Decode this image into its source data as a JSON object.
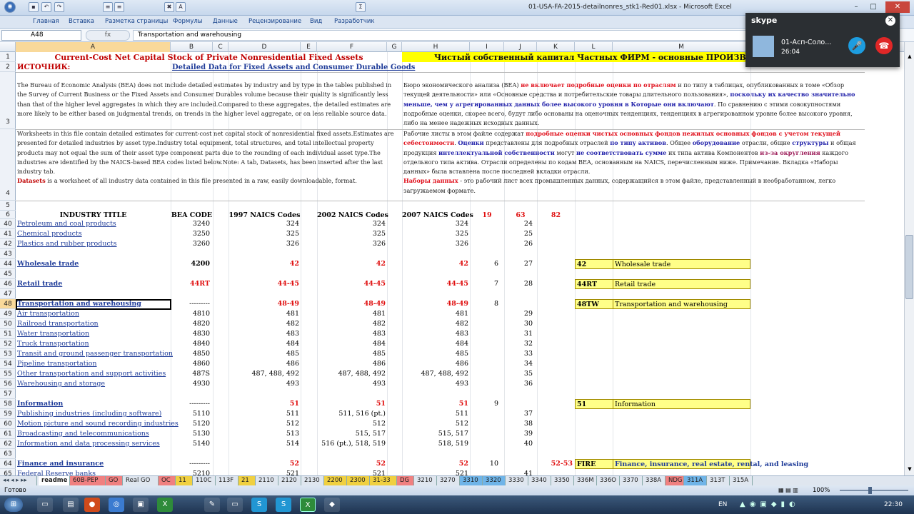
{
  "window": {
    "title": "01-USA-FA-2015-detailnonres_stk1-Red01.xlsx - Microsoft Excel"
  },
  "ribbon_tabs": [
    "Главная",
    "Вставка",
    "Разметка страницы",
    "Формулы",
    "Данные",
    "Рецензирование",
    "Вид",
    "Разработчик"
  ],
  "formula_bar": {
    "name_box": "A48",
    "fx": "fx",
    "value": "Transportation and warehousing"
  },
  "columns": [
    "A",
    "B",
    "C",
    "D",
    "E",
    "F",
    "G",
    "H",
    "I",
    "J",
    "K",
    "L",
    "M"
  ],
  "header": {
    "title_en": "Current-Cost Net Capital Stock of Private Nonresidential Fixed Assets",
    "title_ru": "Чистый собственный капитал Частных ФИРМ - основные ПРОИЗВОД",
    "source_label": "ИСТОЧНИК:",
    "source_link": "Detailed Data for Fixed Assets and Consumer Durable Goods"
  },
  "para_en_1": "The Bureau of Economic Analysis (BEA) does not include detailed estimates by industry and by type in the tables published in the Survey of Current Business or the Fixed Assets and Consumer Durables volume because their quality is significantly less than that of the higher level aggregates in which they are included.Compared to these aggregates, the detailed estimates are more likely to be either based on judgmental trends, on trends in the higher level aggregate, or on less reliable source data.",
  "para_en_2": "Worksheets in this file contain detailed estimates for current-cost net capital stock of nonresidential fixed assets.Estimates are presented for detailed industries by asset type.Industry total equipment, total structures, and total intellectual property products may not equal the sum of their asset type component parts due to the rounding of each individual asset type.The industries are identified by the NAICS-based BEA codes listed below.Note: A tab, Datasets, has been inserted after the last industry tab.",
  "para_en_2b": "Datasets",
  "para_en_2c": " is a worksheet of all industry data contained in this file presented in a raw, easily downloadable, format.",
  "para_ru_1": {
    "a": "Бюро экономического анализа (BEA) ",
    "b": "не включает подробные оценки по отраслям",
    "c": " и по типу в таблицах, опубликованных в томе «Обзор текущей деятельности» или «Основные средства и потребительские товары длительного пользования», ",
    "d": "поскольку их качество значительно меньше, чем у агрегированных данных более высокого уровня в Которые они включают",
    "e": ". По сравнению с этими совокупностями подробные оценки, скорее всего, будут либо основаны на оценочных тенденциях, тенденциях в агрегированном уровне более высокого уровня, либо на менее надежных исходных данных."
  },
  "para_ru_2": {
    "a": "Рабочие листы в этом файле содержат ",
    "b": "подробные оценки чистых основных фондов нежилых основных фондов с учетом текущей себестоимости",
    "c": ". ",
    "d": "Оценки",
    "e": " представлены для подробных отраслей ",
    "f": "по типу активов",
    "g": ". Общее ",
    "h": "оборудование",
    "i": " отрасли, общие ",
    "j": "структуры",
    "k": " и общая продукция ",
    "l": "интеллектуальной собственности",
    "m": " могут ",
    "n": "не соответствовать сумме",
    "o": " их типа актива Компонентов ",
    "p": "из-за округления",
    "q": " каждого отдельного типа актива. Отрасли определены по кодам BEA, основанным на NAICS, перечисленным ниже. Примечание. Вкладка «Наборы данных» была вставлена после последней вкладки отрасли.",
    "r": "Наборы данных",
    "s": " - это рабочий лист всех промышленных данных, содержащийся в этом файле, представленный в необработанном, легко загружаемом формате."
  },
  "table_header": {
    "industry": "INDUSTRY TITLE",
    "bea": "BEA CODE",
    "n1997": "1997 NAICS Codes",
    "n2002": "2002 NAICS Codes",
    "n2007": "2007 NAICS Codes",
    "i": "19",
    "j": "63",
    "k": "82"
  },
  "rows": [
    {
      "num": "40",
      "title": "Petroleum and coal products",
      "bea": "3240",
      "d": "324",
      "f": "324",
      "h": "324",
      "i": "",
      "j": "24",
      "k": "",
      "type": "link"
    },
    {
      "num": "41",
      "title": "Chemical products",
      "bea": "3250",
      "d": "325",
      "f": "325",
      "h": "325",
      "i": "",
      "j": "25",
      "k": "",
      "type": "link"
    },
    {
      "num": "42",
      "title": "Plastics and rubber products",
      "bea": "3260",
      "d": "326",
      "f": "326",
      "h": "326",
      "i": "",
      "j": "26",
      "k": "",
      "type": "link"
    },
    {
      "num": "43",
      "title": "",
      "bea": "",
      "d": "",
      "f": "",
      "h": "",
      "i": "",
      "j": "",
      "k": "",
      "type": "blank"
    },
    {
      "num": "44",
      "title": "Wholesale trade",
      "bea": "4200",
      "d": "42",
      "f": "42",
      "h": "42",
      "i": "6",
      "j": "27",
      "k": "",
      "type": "group"
    },
    {
      "num": "45",
      "title": "",
      "bea": "",
      "d": "",
      "f": "",
      "h": "",
      "i": "",
      "j": "",
      "k": "",
      "type": "blank"
    },
    {
      "num": "46",
      "title": "Retail trade",
      "bea": "44RT",
      "d": "44-45",
      "f": "44-45",
      "h": "44-45",
      "i": "7",
      "j": "28",
      "k": "",
      "type": "group"
    },
    {
      "num": "47",
      "title": "",
      "bea": "",
      "d": "",
      "f": "",
      "h": "",
      "i": "",
      "j": "",
      "k": "",
      "type": "blank"
    },
    {
      "num": "48",
      "title": "Transportation and warehousing",
      "bea": "---------",
      "d": "48-49",
      "f": "48-49",
      "h": "48-49",
      "i": "8",
      "j": "",
      "k": "",
      "type": "group"
    },
    {
      "num": "49",
      "title": "Air transportation",
      "bea": "4810",
      "d": "481",
      "f": "481",
      "h": "481",
      "i": "",
      "j": "29",
      "k": "",
      "type": "link"
    },
    {
      "num": "50",
      "title": "Railroad transportation",
      "bea": "4820",
      "d": "482",
      "f": "482",
      "h": "482",
      "i": "",
      "j": "30",
      "k": "",
      "type": "link"
    },
    {
      "num": "51",
      "title": "Water transportation",
      "bea": "4830",
      "d": "483",
      "f": "483",
      "h": "483",
      "i": "",
      "j": "31",
      "k": "",
      "type": "link"
    },
    {
      "num": "52",
      "title": "Truck transportation",
      "bea": "4840",
      "d": "484",
      "f": "484",
      "h": "484",
      "i": "",
      "j": "32",
      "k": "",
      "type": "link"
    },
    {
      "num": "53",
      "title": "Transit and ground passenger transportation",
      "bea": "4850",
      "d": "485",
      "f": "485",
      "h": "485",
      "i": "",
      "j": "33",
      "k": "",
      "type": "link"
    },
    {
      "num": "54",
      "title": "Pipeline transportation",
      "bea": "4860",
      "d": "486",
      "f": "486",
      "h": "486",
      "i": "",
      "j": "34",
      "k": "",
      "type": "link"
    },
    {
      "num": "55",
      "title": "Other transportation and support activities",
      "bea": "487S",
      "d": "487, 488, 492",
      "f": "487, 488, 492",
      "h": "487, 488, 492",
      "i": "",
      "j": "35",
      "k": "",
      "type": "link"
    },
    {
      "num": "56",
      "title": "Warehousing and storage",
      "bea": "4930",
      "d": "493",
      "f": "493",
      "h": "493",
      "i": "",
      "j": "36",
      "k": "",
      "type": "link"
    },
    {
      "num": "57",
      "title": "",
      "bea": "",
      "d": "",
      "f": "",
      "h": "",
      "i": "",
      "j": "",
      "k": "",
      "type": "blank"
    },
    {
      "num": "58",
      "title": "Information",
      "bea": "---------",
      "d": "51",
      "f": "51",
      "h": "51",
      "i": "9",
      "j": "",
      "k": "",
      "type": "group"
    },
    {
      "num": "59",
      "title": "Publishing industries (including software)",
      "bea": "5110",
      "d": "511",
      "f": "511, 516 (pt.)",
      "h": "511",
      "i": "",
      "j": "37",
      "k": "",
      "type": "link"
    },
    {
      "num": "60",
      "title": "Motion picture and sound recording industries",
      "bea": "5120",
      "d": "512",
      "f": "512",
      "h": "512",
      "i": "",
      "j": "38",
      "k": "",
      "type": "link"
    },
    {
      "num": "61",
      "title": "Broadcasting and telecommunications",
      "bea": "5130",
      "d": "513",
      "f": "515, 517",
      "h": "515, 517",
      "i": "",
      "j": "39",
      "k": "",
      "type": "link"
    },
    {
      "num": "62",
      "title": "Information and data processing services",
      "bea": "5140",
      "d": "514",
      "f": "516 (pt.), 518, 519",
      "h": "518, 519",
      "i": "",
      "j": "40",
      "k": "",
      "type": "link"
    },
    {
      "num": "63",
      "title": "",
      "bea": "",
      "d": "",
      "f": "",
      "h": "",
      "i": "",
      "j": "",
      "k": "",
      "type": "blank"
    },
    {
      "num": "64",
      "title": "Finance and insurance",
      "bea": "---------",
      "d": "52",
      "f": "52",
      "h": "52",
      "i": "10",
      "j": "",
      "k": "52-53",
      "type": "group"
    },
    {
      "num": "65",
      "title": "Federal Reserve banks",
      "bea": "5210",
      "d": "521",
      "f": "521",
      "h": "521",
      "i": "",
      "j": "41",
      "k": "",
      "type": "link"
    }
  ],
  "side_boxes": [
    {
      "row": "44",
      "code": "42",
      "label": "Wholesale trade"
    },
    {
      "row": "46",
      "code": "44RT",
      "label": "Retail trade"
    },
    {
      "row": "48",
      "code": "48TW",
      "label": "Transportation and warehousing"
    },
    {
      "row": "58",
      "code": "51",
      "label": "Information"
    },
    {
      "row": "64",
      "code": "FIRE",
      "label": "Finance, insurance, real estate, rental, and leasing"
    }
  ],
  "sheet_tabs": [
    "readme",
    "60B-PEP",
    "GO",
    "Real GO",
    "OC",
    "11",
    "110C",
    "113F",
    "21",
    "2110",
    "2120",
    "2130",
    "2200",
    "2300",
    "31-33",
    "DG",
    "3210",
    "3270",
    "3310",
    "3320",
    "3330",
    "3340",
    "3350",
    "336M",
    "336O",
    "3370",
    "338A",
    "NDG",
    "311A",
    "313T",
    "315A"
  ],
  "status": {
    "ready": "Готово",
    "zoom": "100%"
  },
  "skype": {
    "brand": "skype",
    "contact": "01-Асп-Соло...",
    "duration": "26:04"
  },
  "taskbar": {
    "lang": "EN",
    "time": "22:30"
  }
}
